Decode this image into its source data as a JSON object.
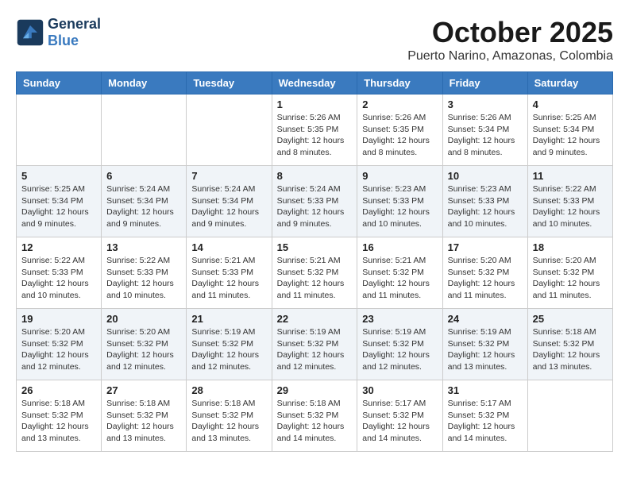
{
  "header": {
    "logo_line1": "General",
    "logo_line2": "Blue",
    "month": "October 2025",
    "location": "Puerto Narino, Amazonas, Colombia"
  },
  "weekdays": [
    "Sunday",
    "Monday",
    "Tuesday",
    "Wednesday",
    "Thursday",
    "Friday",
    "Saturday"
  ],
  "weeks": [
    [
      {
        "day": "",
        "info": ""
      },
      {
        "day": "",
        "info": ""
      },
      {
        "day": "",
        "info": ""
      },
      {
        "day": "1",
        "info": "Sunrise: 5:26 AM\nSunset: 5:35 PM\nDaylight: 12 hours\nand 8 minutes."
      },
      {
        "day": "2",
        "info": "Sunrise: 5:26 AM\nSunset: 5:35 PM\nDaylight: 12 hours\nand 8 minutes."
      },
      {
        "day": "3",
        "info": "Sunrise: 5:26 AM\nSunset: 5:34 PM\nDaylight: 12 hours\nand 8 minutes."
      },
      {
        "day": "4",
        "info": "Sunrise: 5:25 AM\nSunset: 5:34 PM\nDaylight: 12 hours\nand 9 minutes."
      }
    ],
    [
      {
        "day": "5",
        "info": "Sunrise: 5:25 AM\nSunset: 5:34 PM\nDaylight: 12 hours\nand 9 minutes."
      },
      {
        "day": "6",
        "info": "Sunrise: 5:24 AM\nSunset: 5:34 PM\nDaylight: 12 hours\nand 9 minutes."
      },
      {
        "day": "7",
        "info": "Sunrise: 5:24 AM\nSunset: 5:34 PM\nDaylight: 12 hours\nand 9 minutes."
      },
      {
        "day": "8",
        "info": "Sunrise: 5:24 AM\nSunset: 5:33 PM\nDaylight: 12 hours\nand 9 minutes."
      },
      {
        "day": "9",
        "info": "Sunrise: 5:23 AM\nSunset: 5:33 PM\nDaylight: 12 hours\nand 10 minutes."
      },
      {
        "day": "10",
        "info": "Sunrise: 5:23 AM\nSunset: 5:33 PM\nDaylight: 12 hours\nand 10 minutes."
      },
      {
        "day": "11",
        "info": "Sunrise: 5:22 AM\nSunset: 5:33 PM\nDaylight: 12 hours\nand 10 minutes."
      }
    ],
    [
      {
        "day": "12",
        "info": "Sunrise: 5:22 AM\nSunset: 5:33 PM\nDaylight: 12 hours\nand 10 minutes."
      },
      {
        "day": "13",
        "info": "Sunrise: 5:22 AM\nSunset: 5:33 PM\nDaylight: 12 hours\nand 10 minutes."
      },
      {
        "day": "14",
        "info": "Sunrise: 5:21 AM\nSunset: 5:33 PM\nDaylight: 12 hours\nand 11 minutes."
      },
      {
        "day": "15",
        "info": "Sunrise: 5:21 AM\nSunset: 5:32 PM\nDaylight: 12 hours\nand 11 minutes."
      },
      {
        "day": "16",
        "info": "Sunrise: 5:21 AM\nSunset: 5:32 PM\nDaylight: 12 hours\nand 11 minutes."
      },
      {
        "day": "17",
        "info": "Sunrise: 5:20 AM\nSunset: 5:32 PM\nDaylight: 12 hours\nand 11 minutes."
      },
      {
        "day": "18",
        "info": "Sunrise: 5:20 AM\nSunset: 5:32 PM\nDaylight: 12 hours\nand 11 minutes."
      }
    ],
    [
      {
        "day": "19",
        "info": "Sunrise: 5:20 AM\nSunset: 5:32 PM\nDaylight: 12 hours\nand 12 minutes."
      },
      {
        "day": "20",
        "info": "Sunrise: 5:20 AM\nSunset: 5:32 PM\nDaylight: 12 hours\nand 12 minutes."
      },
      {
        "day": "21",
        "info": "Sunrise: 5:19 AM\nSunset: 5:32 PM\nDaylight: 12 hours\nand 12 minutes."
      },
      {
        "day": "22",
        "info": "Sunrise: 5:19 AM\nSunset: 5:32 PM\nDaylight: 12 hours\nand 12 minutes."
      },
      {
        "day": "23",
        "info": "Sunrise: 5:19 AM\nSunset: 5:32 PM\nDaylight: 12 hours\nand 12 minutes."
      },
      {
        "day": "24",
        "info": "Sunrise: 5:19 AM\nSunset: 5:32 PM\nDaylight: 12 hours\nand 13 minutes."
      },
      {
        "day": "25",
        "info": "Sunrise: 5:18 AM\nSunset: 5:32 PM\nDaylight: 12 hours\nand 13 minutes."
      }
    ],
    [
      {
        "day": "26",
        "info": "Sunrise: 5:18 AM\nSunset: 5:32 PM\nDaylight: 12 hours\nand 13 minutes."
      },
      {
        "day": "27",
        "info": "Sunrise: 5:18 AM\nSunset: 5:32 PM\nDaylight: 12 hours\nand 13 minutes."
      },
      {
        "day": "28",
        "info": "Sunrise: 5:18 AM\nSunset: 5:32 PM\nDaylight: 12 hours\nand 13 minutes."
      },
      {
        "day": "29",
        "info": "Sunrise: 5:18 AM\nSunset: 5:32 PM\nDaylight: 12 hours\nand 14 minutes."
      },
      {
        "day": "30",
        "info": "Sunrise: 5:17 AM\nSunset: 5:32 PM\nDaylight: 12 hours\nand 14 minutes."
      },
      {
        "day": "31",
        "info": "Sunrise: 5:17 AM\nSunset: 5:32 PM\nDaylight: 12 hours\nand 14 minutes."
      },
      {
        "day": "",
        "info": ""
      }
    ]
  ]
}
